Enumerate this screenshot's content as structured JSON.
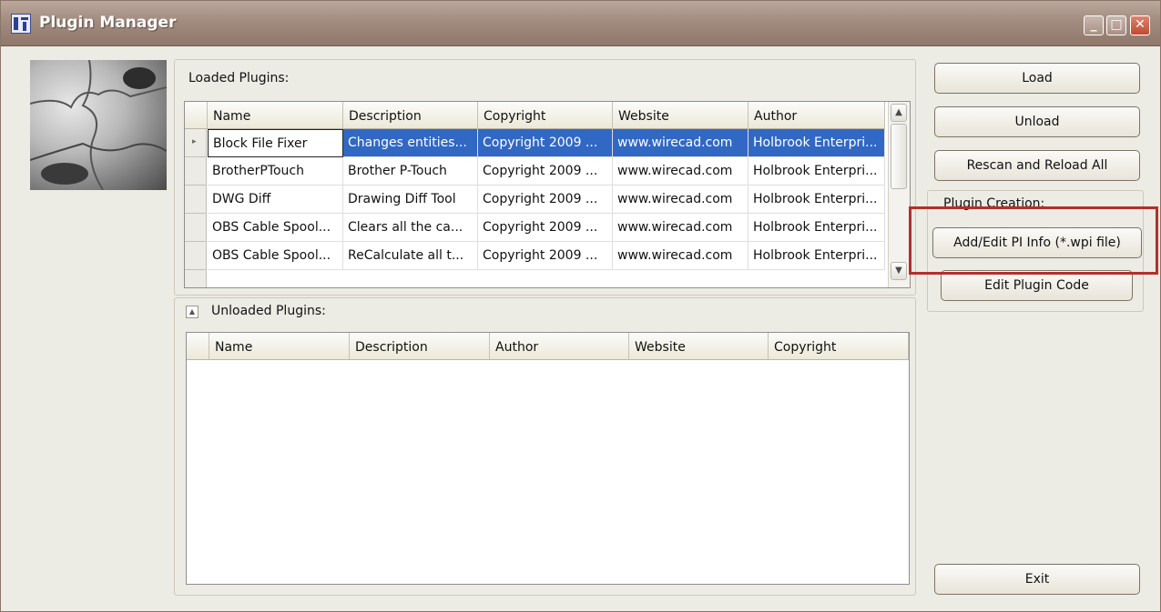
{
  "window": {
    "title": "Plugin Manager",
    "app_icon": "plugin-manager-app-icon",
    "controls": {
      "minimize": "_",
      "maximize": "□",
      "close": "✕"
    }
  },
  "loaded": {
    "label": "Loaded Plugins:",
    "columns": [
      "Name",
      "Description",
      "Copyright",
      "Website",
      "Author"
    ],
    "rows": [
      [
        "Block File Fixer",
        "Changes entities...",
        "Copyright 2009 ...",
        "www.wirecad.com",
        "Holbrook Enterpri..."
      ],
      [
        "BrotherPTouch",
        "Brother P-Touch",
        "Copyright 2009 ...",
        "www.wirecad.com",
        "Holbrook Enterpri..."
      ],
      [
        "DWG Diff",
        "Drawing Diff Tool",
        "Copyright 2009 ...",
        "www.wirecad.com",
        "Holbrook Enterpri..."
      ],
      [
        "OBS Cable Spool...",
        "Clears all the ca...",
        "Copyright 2009 ...",
        "www.wirecad.com",
        "Holbrook Enterpri..."
      ],
      [
        "OBS Cable Spool...",
        "ReCalculate all t...",
        "Copyright 2009 ...",
        "www.wirecad.com",
        "Holbrook Enterpri..."
      ]
    ],
    "selected_row_marker": "▸",
    "scroll_up": "▲",
    "scroll_down": "▼"
  },
  "unloaded": {
    "label": "Unloaded Plugins:",
    "collapse_glyph": "▲",
    "columns": [
      "Name",
      "Description",
      "Author",
      "Website",
      "Copyright"
    ]
  },
  "buttons": {
    "load": "Load",
    "unload": "Unload",
    "rescan": "Rescan and Reload All",
    "creation_label": "Plugin Creation:",
    "add_edit": "Add/Edit PI Info (*.wpi file)",
    "edit_code": "Edit Plugin Code",
    "exit": "Exit"
  },
  "colors": {
    "selection": "#3168c4",
    "highlight_box": "#b2302a",
    "titlebar": "#a28b7f"
  }
}
